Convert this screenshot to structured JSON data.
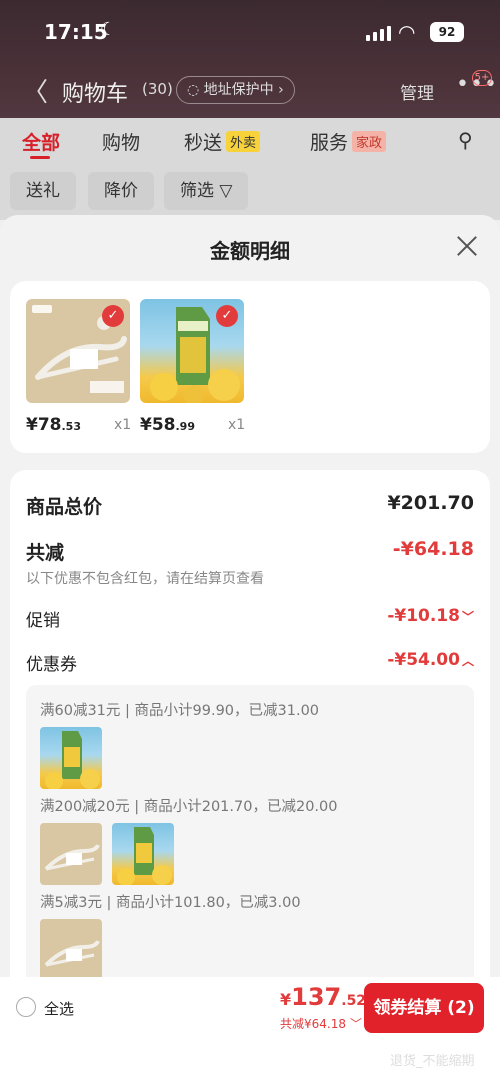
{
  "status_bar": {
    "time": "17:15",
    "battery": "92"
  },
  "nav": {
    "title": "购物车",
    "count": "(30)",
    "address_protect": "地址保护中",
    "manage": "管理",
    "msg_badge": "5+"
  },
  "tabs": [
    {
      "label": "全部"
    },
    {
      "label": "购物"
    },
    {
      "label": "秒送",
      "tag": "外卖"
    },
    {
      "label": "服务",
      "tag": "家政"
    }
  ],
  "filters": [
    "送礼",
    "降价",
    "筛选 ▽"
  ],
  "sheet": {
    "title": "金额明细",
    "products": [
      {
        "price_int": "¥78",
        "price_dec": ".53",
        "qty": "x1"
      },
      {
        "price_int": "¥58",
        "price_dec": ".99",
        "qty": "x1"
      }
    ],
    "summary": {
      "total_label": "商品总价",
      "total_value": "¥201.70",
      "reduce_label": "共减",
      "reduce_value": "-¥64.18",
      "note": "以下优惠不包含红包，请在结算页查看",
      "promo_label": "促销",
      "promo_value": "-¥10.18",
      "coupon_label": "优惠券",
      "coupon_value": "-¥54.00"
    },
    "coupons": [
      "满60减31元 | 商品小计99.90，已减31.00",
      "满200减20元 | 商品小计201.70，已减20.00",
      "满5减3元 | 商品小计101.80，已减3.00"
    ]
  },
  "bottom": {
    "select_all": "全选",
    "currency": "¥",
    "total_int": "137",
    "total_dec": ".52",
    "saved": "共减¥64.18",
    "checkout": "领券结算 (2)",
    "watermark": "退货_不能缩期"
  }
}
